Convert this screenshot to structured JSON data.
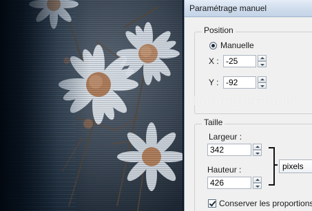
{
  "window": {
    "title": "Paramétrage manuel"
  },
  "watermark": "PhotofiltreGraphic",
  "position": {
    "group_label": "Position",
    "mode_label": "Manuelle",
    "mode_selected": true,
    "x_label": "X :",
    "x_value": "-25",
    "y_label": "Y :",
    "y_value": "-92"
  },
  "size": {
    "group_label": "Taille",
    "width_label": "Largeur :",
    "width_value": "342",
    "height_label": "Hauteur :",
    "height_value": "426",
    "unit": "pixels",
    "keep_proportions_label": "Conserver les proportions",
    "keep_proportions_checked": true
  },
  "colors": {
    "titlebar": "#cfdcec",
    "dialog_bg": "#f0f0f0"
  }
}
